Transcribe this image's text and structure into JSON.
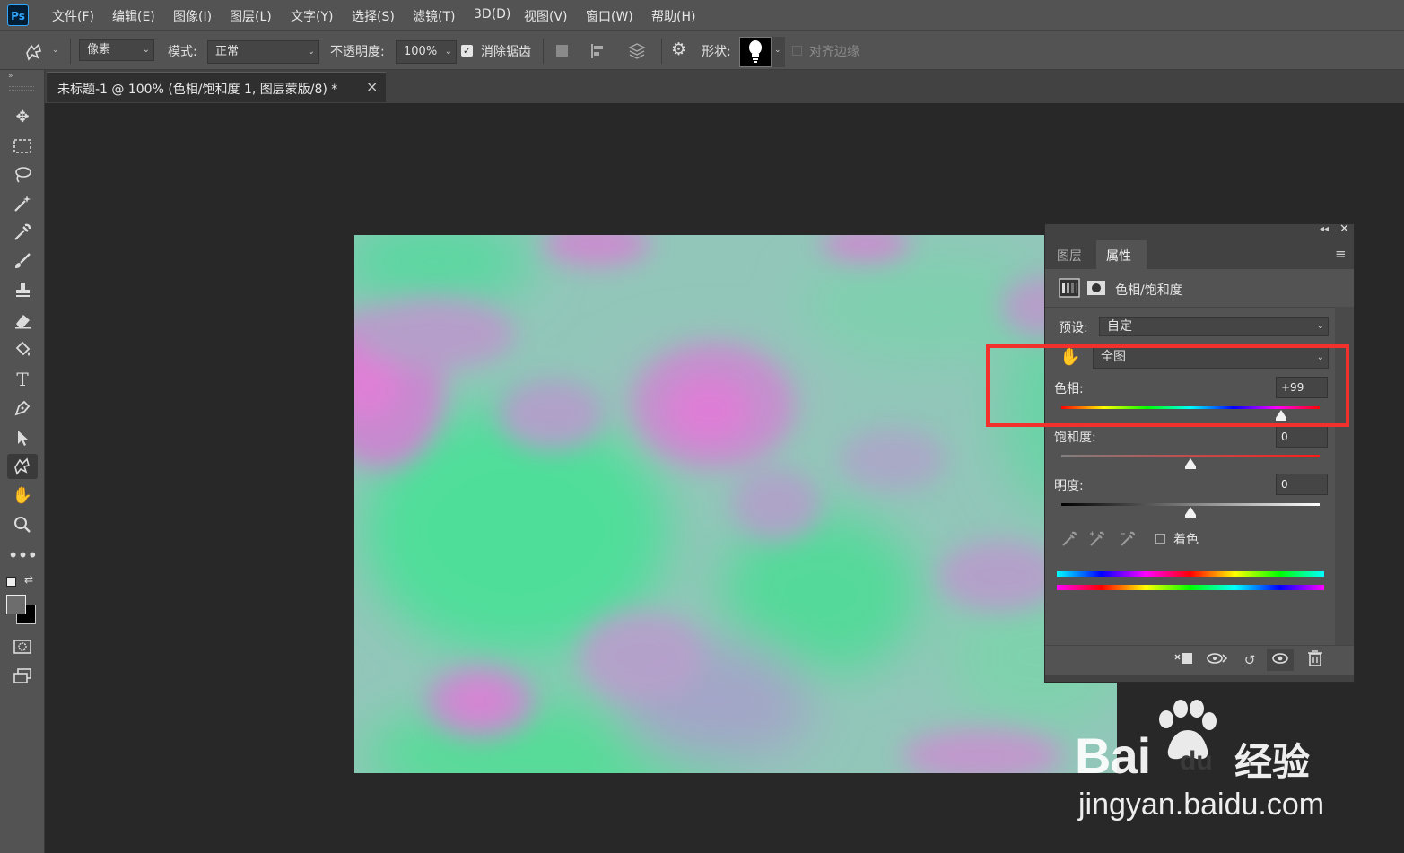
{
  "app": {
    "logo": "Ps"
  },
  "menu": [
    "文件(F)",
    "编辑(E)",
    "图像(I)",
    "图层(L)",
    "文字(Y)",
    "选择(S)",
    "滤镜(T)",
    "3D(D)",
    "视图(V)",
    "窗口(W)",
    "帮助(H)"
  ],
  "options": {
    "tool_mode_value": "像素",
    "mode_label": "模式:",
    "mode_value": "正常",
    "opacity_label": "不透明度:",
    "opacity_value": "100%",
    "antialias_label": "消除锯齿",
    "antialias_checked": true,
    "shape_label": "形状:",
    "align_edges_label": "对齐边缘"
  },
  "document": {
    "tab_title": "未标题-1 @ 100% (色相/饱和度 1, 图层蒙版/8) *",
    "close_glyph": "×"
  },
  "panel": {
    "tabs": [
      "图层",
      "属性"
    ],
    "active_tab": "属性",
    "adjustment_title": "色相/饱和度",
    "preset_label": "预设:",
    "preset_value": "自定",
    "channel_value": "全图",
    "hue_label": "色相:",
    "hue_value": "+99",
    "saturation_label": "饱和度:",
    "saturation_value": "0",
    "lightness_label": "明度:",
    "lightness_value": "0",
    "colorize_label": "着色",
    "colorize_checked": false,
    "hue_position": 0.85,
    "saturation_position": 0.5,
    "lightness_position": 0.5
  },
  "watermark": {
    "brand": "Bai",
    "brand2": "du",
    "cn": "经验",
    "url": "jingyan.baidu.com"
  },
  "colors": {
    "highlight": "#f2312d",
    "ui_dark": "#535353",
    "canvas_bg": "#282828"
  }
}
